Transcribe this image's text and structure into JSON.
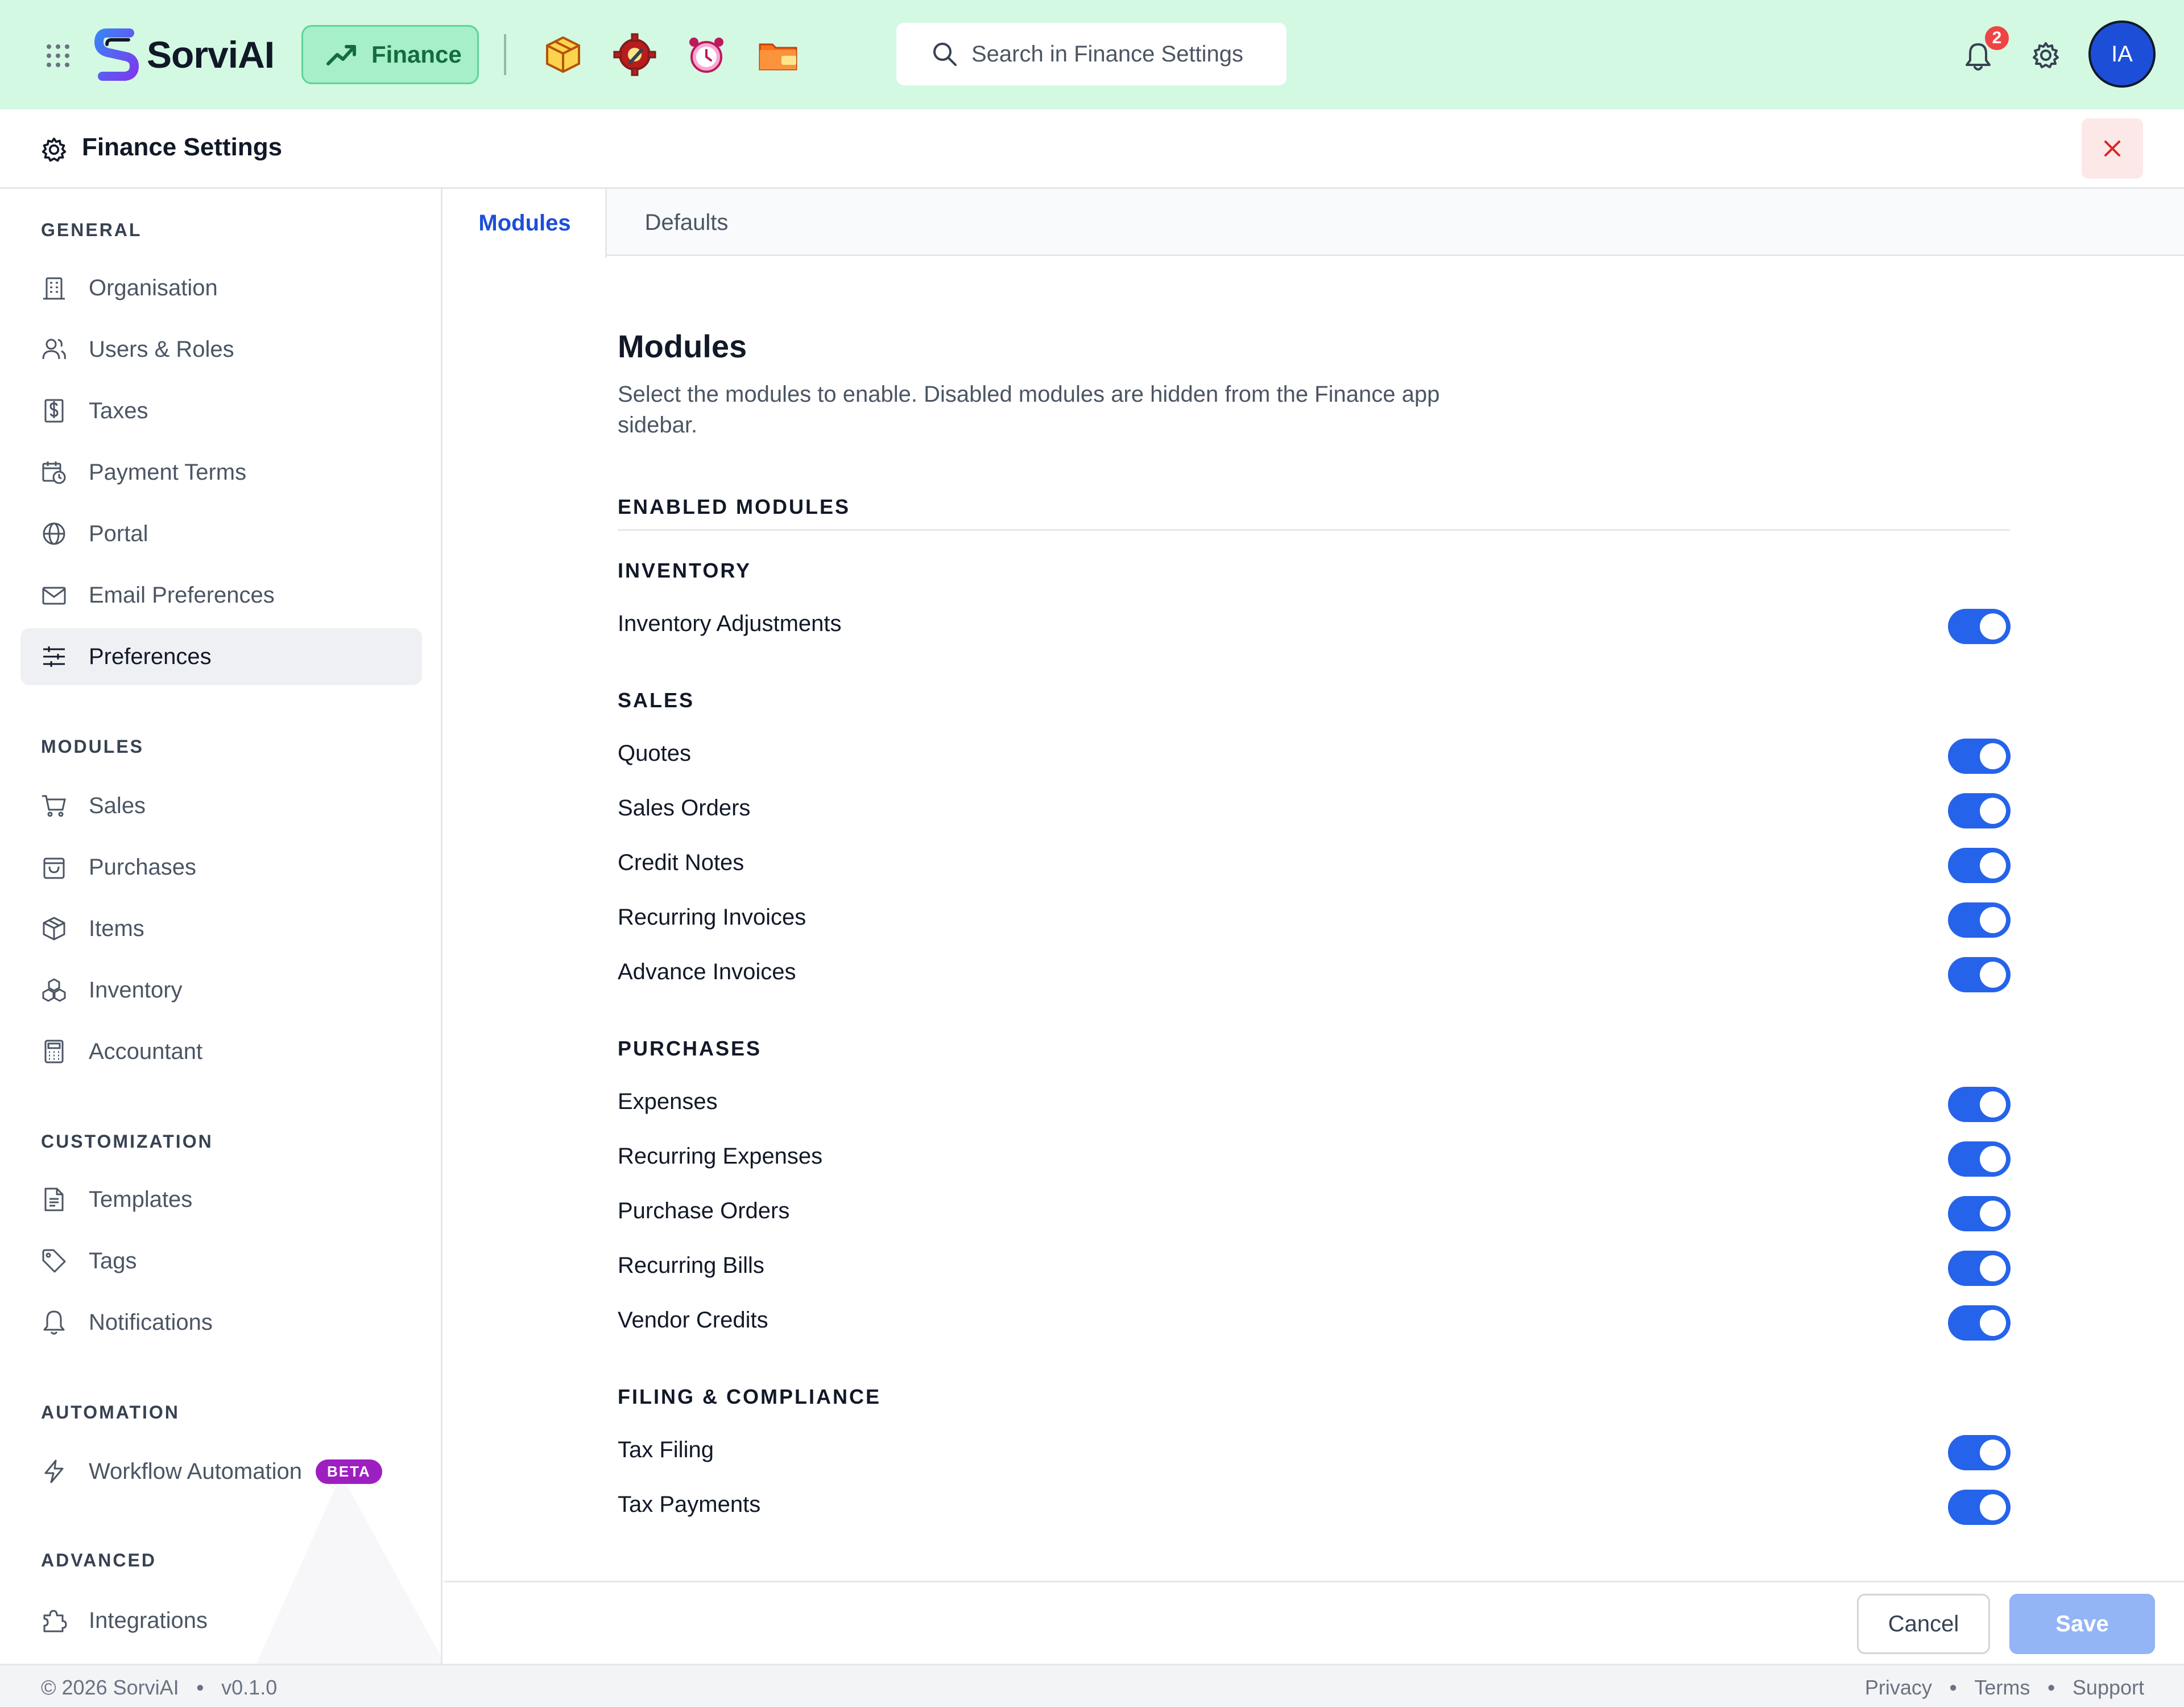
{
  "header": {
    "brand": "SorviAI",
    "app_label": "Finance",
    "search_placeholder": "Search in Finance Settings",
    "notification_count": "2",
    "avatar_initials": "IA",
    "app_icons": [
      "box-app-icon",
      "gear-wrench-app-icon",
      "alarm-clock-app-icon",
      "folder-app-icon"
    ]
  },
  "settings": {
    "title": "Finance Settings"
  },
  "sidebar": {
    "sections": [
      {
        "label": "GENERAL",
        "items": [
          {
            "label": "Organisation",
            "icon": "building-icon"
          },
          {
            "label": "Users & Roles",
            "icon": "users-icon"
          },
          {
            "label": "Taxes",
            "icon": "dollar-receipt-icon"
          },
          {
            "label": "Payment Terms",
            "icon": "calendar-clock-icon"
          },
          {
            "label": "Portal",
            "icon": "globe-icon"
          },
          {
            "label": "Email Preferences",
            "icon": "mail-icon"
          },
          {
            "label": "Preferences",
            "icon": "sliders-icon",
            "active": true
          }
        ]
      },
      {
        "label": "MODULES",
        "items": [
          {
            "label": "Sales",
            "icon": "cart-icon"
          },
          {
            "label": "Purchases",
            "icon": "shopping-bag-icon"
          },
          {
            "label": "Items",
            "icon": "package-icon"
          },
          {
            "label": "Inventory",
            "icon": "boxes-icon"
          },
          {
            "label": "Accountant",
            "icon": "calculator-icon"
          }
        ]
      },
      {
        "label": "CUSTOMIZATION",
        "items": [
          {
            "label": "Templates",
            "icon": "document-icon"
          },
          {
            "label": "Tags",
            "icon": "tag-icon"
          },
          {
            "label": "Notifications",
            "icon": "bell-icon"
          }
        ]
      },
      {
        "label": "AUTOMATION",
        "items": [
          {
            "label": "Workflow Automation",
            "icon": "lightning-icon",
            "badge": "BETA"
          }
        ]
      },
      {
        "label": "ADVANCED",
        "items": [
          {
            "label": "Integrations",
            "icon": "puzzle-icon"
          }
        ]
      }
    ]
  },
  "tabs": [
    {
      "label": "Modules",
      "active": true
    },
    {
      "label": "Defaults",
      "active": false
    }
  ],
  "main": {
    "title": "Modules",
    "description": "Select the modules to enable. Disabled modules are hidden from the Finance app sidebar.",
    "enabled_label": "ENABLED MODULES",
    "groups": [
      {
        "label": "INVENTORY",
        "items": [
          {
            "label": "Inventory Adjustments",
            "enabled": true
          }
        ]
      },
      {
        "label": "SALES",
        "items": [
          {
            "label": "Quotes",
            "enabled": true
          },
          {
            "label": "Sales Orders",
            "enabled": true
          },
          {
            "label": "Credit Notes",
            "enabled": true
          },
          {
            "label": "Recurring Invoices",
            "enabled": true
          },
          {
            "label": "Advance Invoices",
            "enabled": true
          }
        ]
      },
      {
        "label": "PURCHASES",
        "items": [
          {
            "label": "Expenses",
            "enabled": true
          },
          {
            "label": "Recurring Expenses",
            "enabled": true
          },
          {
            "label": "Purchase Orders",
            "enabled": true
          },
          {
            "label": "Recurring Bills",
            "enabled": true
          },
          {
            "label": "Vendor Credits",
            "enabled": true
          }
        ]
      },
      {
        "label": "FILING & COMPLIANCE",
        "items": [
          {
            "label": "Tax Filing",
            "enabled": true
          },
          {
            "label": "Tax Payments",
            "enabled": true
          }
        ]
      }
    ]
  },
  "actions": {
    "cancel": "Cancel",
    "save": "Save"
  },
  "footer": {
    "copyright": "© 2026 SorviAI",
    "version": "v0.1.0",
    "links": [
      "Privacy",
      "Terms",
      "Support"
    ]
  },
  "colors": {
    "header_bg": "#d3f9e3",
    "accent": "#2563eb",
    "brand_green": "#146b3f",
    "beta_badge": "#9d1fc0"
  }
}
